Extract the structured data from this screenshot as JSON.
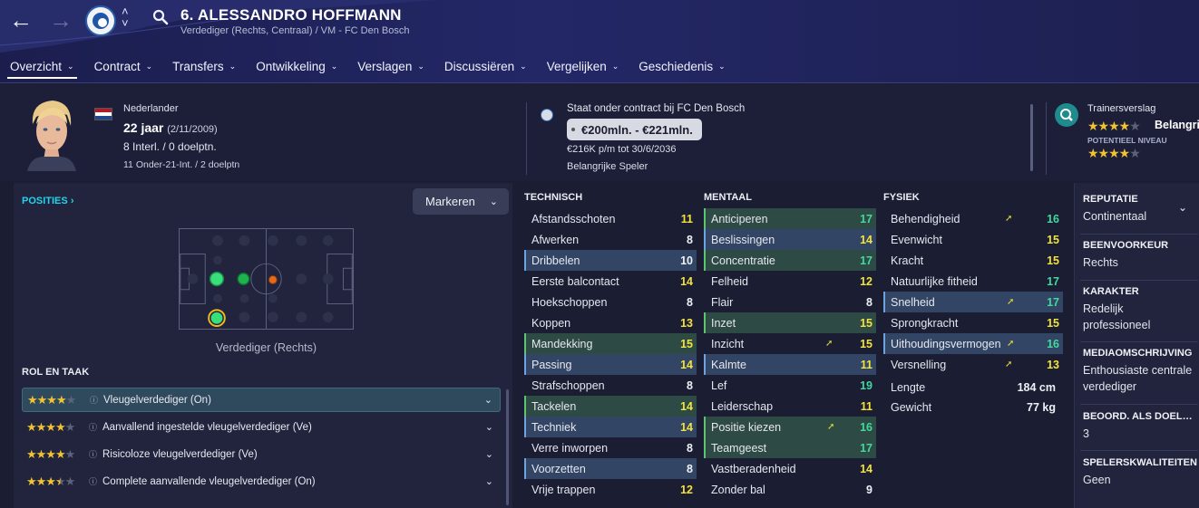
{
  "header": {
    "title": "6. ALESSANDRO HOFFMANN",
    "subtitle": "Verdediger (Rechts, Centraal) / VM - FC Den Bosch",
    "tabs": [
      {
        "label": "Overzicht",
        "active": true
      },
      {
        "label": "Contract"
      },
      {
        "label": "Transfers"
      },
      {
        "label": "Ontwikkeling"
      },
      {
        "label": "Verslagen"
      },
      {
        "label": "Discussiëren"
      },
      {
        "label": "Vergelijken"
      },
      {
        "label": "Geschiedenis"
      }
    ]
  },
  "profile": {
    "nationality": "Nederlander",
    "age": "22 jaar",
    "dob": "(2/11/2009)",
    "caps": "8 Interl. / 0 doelptn.",
    "u21": "11 Onder-21-Int. / 2 doelptn",
    "flag_colors": [
      "#ae1c28",
      "#ffffff",
      "#21468b"
    ]
  },
  "contract": {
    "text": "Staat onder contract bij FC Den Bosch",
    "value": "€200mln. - €221mln.",
    "wage": "€216K p/m tot 30/6/2036",
    "status": "Belangrijke Speler"
  },
  "trainer": {
    "label": "Trainersverslag",
    "current_text": "Belangrijk",
    "potential_label": "POTENTIEEL NIVEAU",
    "current_stars": 4,
    "potential_stars": 4
  },
  "positions": {
    "label": "POSITIES",
    "mark_button": "Markeren",
    "caption": "Verdediger (Rechts)"
  },
  "roles": {
    "label": "ROL EN TAAK",
    "items": [
      {
        "stars": 4,
        "name": "Vleugelverdediger (On)",
        "selected": true
      },
      {
        "stars": 4,
        "name": "Aanvallend ingestelde vleugelverdediger (Ve)"
      },
      {
        "stars": 4,
        "name": "Risicoloze vleugelverdediger (Ve)"
      },
      {
        "stars": 3.5,
        "name": "Complete aanvallende vleugelverdediger (On)"
      }
    ]
  },
  "attributes": {
    "technical": {
      "label": "TECHNISCH",
      "rows": [
        {
          "name": "Afstandsschoten",
          "value": "11",
          "c": "y"
        },
        {
          "name": "Afwerken",
          "value": "8",
          "c": "w"
        },
        {
          "name": "Dribbelen",
          "value": "10",
          "c": "w",
          "hl": "blue"
        },
        {
          "name": "Eerste balcontact",
          "value": "14",
          "c": "y"
        },
        {
          "name": "Hoekschoppen",
          "value": "8",
          "c": "w"
        },
        {
          "name": "Koppen",
          "value": "13",
          "c": "y"
        },
        {
          "name": "Mandekking",
          "value": "15",
          "c": "y",
          "hl": "green"
        },
        {
          "name": "Passing",
          "value": "14",
          "c": "y",
          "hl": "blue"
        },
        {
          "name": "Strafschoppen",
          "value": "8",
          "c": "w"
        },
        {
          "name": "Tackelen",
          "value": "14",
          "c": "y",
          "hl": "green"
        },
        {
          "name": "Techniek",
          "value": "14",
          "c": "y",
          "hl": "blue"
        },
        {
          "name": "Verre inworpen",
          "value": "8",
          "c": "w"
        },
        {
          "name": "Voorzetten",
          "value": "8",
          "c": "w",
          "hl": "blue"
        },
        {
          "name": "Vrije trappen",
          "value": "12",
          "c": "y"
        }
      ]
    },
    "mental": {
      "label": "MENTAAL",
      "rows": [
        {
          "name": "Anticiperen",
          "value": "17",
          "c": "g",
          "hl": "green"
        },
        {
          "name": "Beslissingen",
          "value": "14",
          "c": "y",
          "hl": "blue"
        },
        {
          "name": "Concentratie",
          "value": "17",
          "c": "g",
          "hl": "green"
        },
        {
          "name": "Felheid",
          "value": "12",
          "c": "y"
        },
        {
          "name": "Flair",
          "value": "8",
          "c": "w"
        },
        {
          "name": "Inzet",
          "value": "15",
          "c": "y",
          "hl": "green"
        },
        {
          "name": "Inzicht",
          "value": "15",
          "c": "y",
          "trend": true
        },
        {
          "name": "Kalmte",
          "value": "11",
          "c": "y",
          "hl": "blue"
        },
        {
          "name": "Lef",
          "value": "19",
          "c": "g"
        },
        {
          "name": "Leiderschap",
          "value": "11",
          "c": "y"
        },
        {
          "name": "Positie kiezen",
          "value": "16",
          "c": "g",
          "hl": "green",
          "trend": true
        },
        {
          "name": "Teamgeest",
          "value": "17",
          "c": "g",
          "hl": "green"
        },
        {
          "name": "Vastberadenheid",
          "value": "14",
          "c": "y"
        },
        {
          "name": "Zonder bal",
          "value": "9",
          "c": "w"
        }
      ]
    },
    "physical": {
      "label": "FYSIEK",
      "rows": [
        {
          "name": "Behendigheid",
          "value": "16",
          "c": "g",
          "trend": true
        },
        {
          "name": "Evenwicht",
          "value": "15",
          "c": "y"
        },
        {
          "name": "Kracht",
          "value": "15",
          "c": "y"
        },
        {
          "name": "Natuurlijke fitheid",
          "value": "17",
          "c": "g"
        },
        {
          "name": "Snelheid",
          "value": "17",
          "c": "g",
          "hl": "blue",
          "trend": true
        },
        {
          "name": "Sprongkracht",
          "value": "15",
          "c": "y"
        },
        {
          "name": "Uithoudingsvermogen",
          "value": "16",
          "c": "g",
          "hl": "blue",
          "trend": true
        },
        {
          "name": "Versnelling",
          "value": "13",
          "c": "y",
          "trend": true
        }
      ],
      "length_label": "Lengte",
      "length_value": "184 cm",
      "weight_label": "Gewicht",
      "weight_value": "77 kg"
    }
  },
  "side": {
    "reputation_label": "REPUTATIE",
    "reputation": "Continentaal",
    "foot_label": "BEENVOORKEUR",
    "foot": "Rechts",
    "character_label": "KARAKTER",
    "character": "Redelijk professioneel",
    "media_label": "MEDIAOMSCHRIJVING",
    "media": "Enthousiaste centrale verdediger",
    "rating_label": "BEOORD. ALS DOELMAN",
    "rating": "3",
    "quality_label": "SPELERSKWALITEITEN",
    "quality": "Geen"
  },
  "colors": {
    "accent": "#22d3ee",
    "yellow": "#f4e33a",
    "green": "#42d99d"
  }
}
